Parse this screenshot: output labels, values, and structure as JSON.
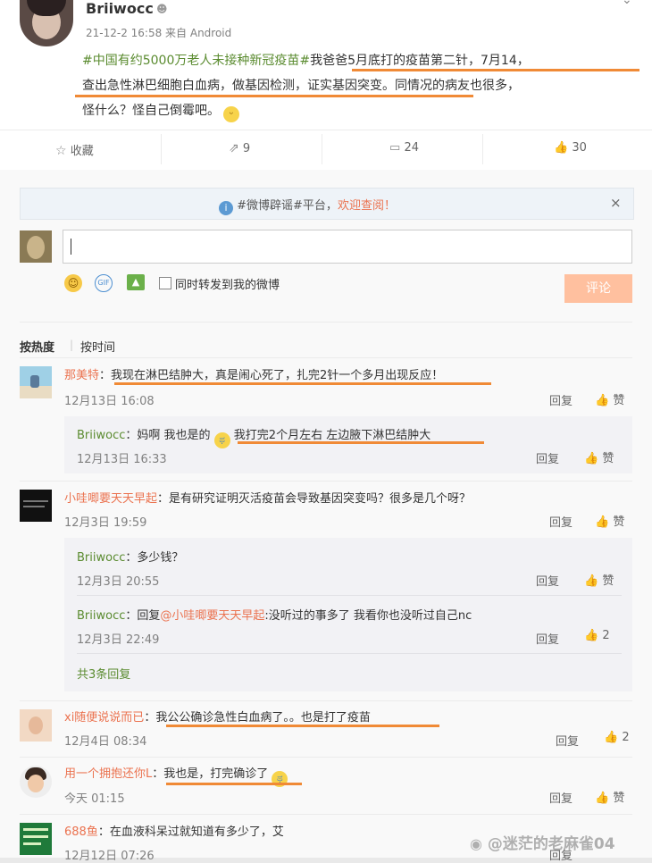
{
  "post": {
    "author": "Briiwocc",
    "meta": "21-12-2 16:58 来自 Android",
    "hashtag": "#中国有约5000万老人未接种新冠疫苗#",
    "text1": "我爸爸5月底打的疫苗第二针，7月14，",
    "text2": "查出急性淋巴细胞白血病，做基因检测，证实基因突变。同情况的病友也很多，",
    "text3": "怪什么？怪自己倒霉吧。"
  },
  "actions": {
    "fav": "收藏",
    "share": "9",
    "comment": "24",
    "like": "30"
  },
  "notice": {
    "topic": "#微博辟谣#平台，",
    "link": "欢迎查阅！"
  },
  "composer": {
    "forward": "同时转发到我的微博",
    "submit": "评论"
  },
  "sort": {
    "hot": "按热度",
    "time": "按时间"
  },
  "comments": [
    {
      "user": "那美特",
      "text": "：我现在淋巴结肿大，真是闹心死了，扎完2针一个多月出现反应！",
      "time": "12月13日 16:08",
      "reply": "回复",
      "like": "赞",
      "replies": [
        {
          "user": "Briiwocc",
          "text_a": "：妈啊 我也是的",
          "text_b": "我打完2个月左右 左边腋下淋巴结肿大",
          "time": "12月13日 16:33",
          "reply": "回复",
          "like": "赞"
        }
      ]
    },
    {
      "user": "小哇唧要天天早起",
      "text": "：是有研究证明灭活疫苗会导致基因突变吗？很多是几个呀？",
      "time": "12月3日 19:59",
      "reply": "回复",
      "like": "赞",
      "replies": [
        {
          "user": "Briiwocc",
          "text": "：多少钱？",
          "time": "12月3日 20:55",
          "reply": "回复",
          "like": "赞"
        },
        {
          "user": "Briiwocc",
          "text_a": "：回复",
          "mention": "@小哇唧要天天早起",
          "text_b": ":没听过的事多了 我看你也没听过自己nc",
          "time": "12月3日 22:49",
          "reply": "回复",
          "like": "2"
        }
      ],
      "more": "共3条回复"
    },
    {
      "user": "xi随便说说而已",
      "text": "：我公公确诊急性白血病了。。也是打了疫苗",
      "time": "12月4日 08:34",
      "reply": "回复",
      "like": "2"
    },
    {
      "user": "用一个拥抱还你L",
      "text": "：我也是，打完确诊了",
      "time": "今天 01:15",
      "reply": "回复",
      "like": "赞"
    },
    {
      "user": "688鱼",
      "text": "：在血液科呆过就知道有多少了，艾",
      "time": "12月12日 07:26",
      "reply": "回复"
    }
  ],
  "watermark": "@迷茫的老麻雀04",
  "colors": {
    "link": "#eb7350",
    "green": "#5a8b2f",
    "underline": "#f08a36"
  }
}
